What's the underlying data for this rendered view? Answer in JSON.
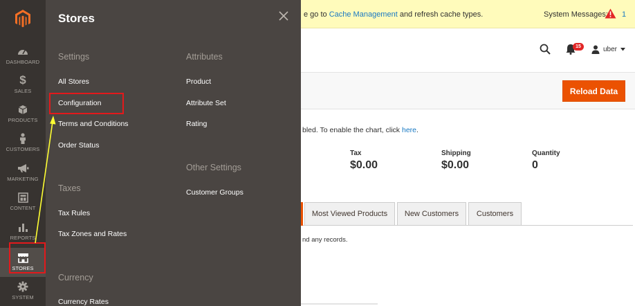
{
  "sidebar": {
    "logo": "magento-logo-icon",
    "items": [
      {
        "label": "DASHBOARD",
        "icon": "dashboard-icon"
      },
      {
        "label": "SALES",
        "icon": "dollar-icon"
      },
      {
        "label": "PRODUCTS",
        "icon": "cube-icon"
      },
      {
        "label": "CUSTOMERS",
        "icon": "person-icon"
      },
      {
        "label": "MARKETING",
        "icon": "megaphone-icon"
      },
      {
        "label": "CONTENT",
        "icon": "layout-icon"
      },
      {
        "label": "REPORTS",
        "icon": "bar-chart-icon"
      },
      {
        "label": "STORES",
        "icon": "storefront-icon"
      },
      {
        "label": "SYSTEM",
        "icon": "gear-icon"
      }
    ]
  },
  "flyout": {
    "title": "Stores",
    "settings": {
      "heading": "Settings",
      "links": [
        "All Stores",
        "Configuration",
        "Terms and Conditions",
        "Order Status"
      ]
    },
    "taxes": {
      "heading": "Taxes",
      "links": [
        "Tax Rules",
        "Tax Zones and Rates"
      ]
    },
    "currency": {
      "heading": "Currency",
      "links": [
        "Currency Rates"
      ]
    },
    "attributes": {
      "heading": "Attributes",
      "links": [
        "Product",
        "Attribute Set",
        "Rating"
      ]
    },
    "other": {
      "heading": "Other Settings",
      "links": [
        "Customer Groups"
      ]
    }
  },
  "message": {
    "prefix": "e go to ",
    "link": "Cache Management",
    "suffix": " and refresh cache types.",
    "system_label": "System Messages:",
    "system_count": "1"
  },
  "header": {
    "notification_count": "15",
    "user": "uber"
  },
  "toolbar": {
    "reload_label": "Reload Data"
  },
  "chart_note": {
    "prefix": "bled. To enable the chart, click ",
    "link": "here",
    "suffix": "."
  },
  "stats": [
    {
      "label": "Tax",
      "value": "$0.00"
    },
    {
      "label": "Shipping",
      "value": "$0.00"
    },
    {
      "label": "Quantity",
      "value": "0"
    }
  ],
  "tabs": [
    "Most Viewed Products",
    "New Customers",
    "Customers"
  ],
  "empty_note": "nd any records.",
  "colors": {
    "sidebar_bg": "#373330",
    "flyout_bg": "#4a4542",
    "accent": "#eb5202",
    "link": "#1979c3",
    "annotation": "#e3191b",
    "arrow": "#ffff33"
  }
}
